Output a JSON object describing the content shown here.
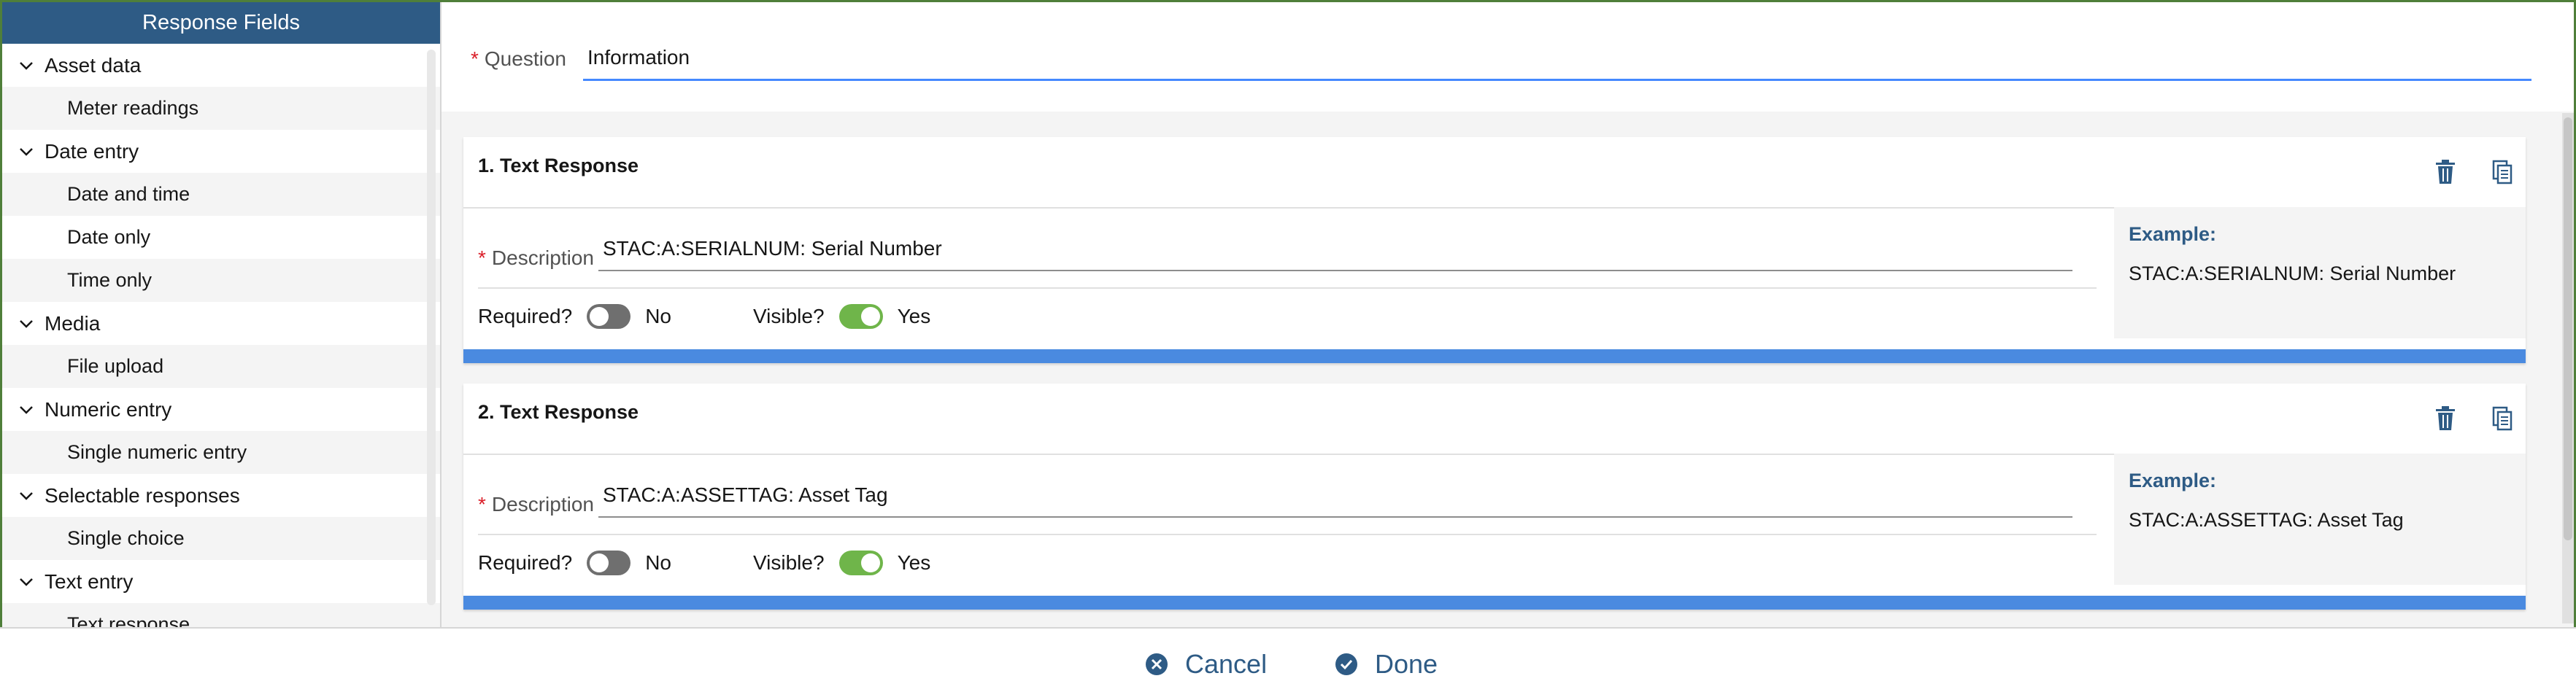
{
  "sidebar": {
    "title": "Response Fields",
    "groups": [
      {
        "label": "Asset data",
        "items": [
          "Meter readings"
        ]
      },
      {
        "label": "Date entry",
        "items": [
          "Date and time",
          "Date only",
          "Time only"
        ]
      },
      {
        "label": "Media",
        "items": [
          "File upload"
        ]
      },
      {
        "label": "Numeric entry",
        "items": [
          "Single numeric entry"
        ]
      },
      {
        "label": "Selectable responses",
        "items": [
          "Single choice"
        ]
      },
      {
        "label": "Text entry",
        "items": [
          "Text response"
        ]
      }
    ]
  },
  "question": {
    "required_mark": "*",
    "label": "Question",
    "value": "Information"
  },
  "responses": [
    {
      "title": "1. Text Response",
      "required_mark": "*",
      "description_label": "Description",
      "description_value": "STAC:A:SERIALNUM: Serial Number",
      "required_label": "Required?",
      "required_state": "No",
      "visible_label": "Visible?",
      "visible_state": "Yes",
      "example_label": "Example:",
      "example_value": "STAC:A:SERIALNUM: Serial Number"
    },
    {
      "title": "2. Text Response",
      "required_mark": "*",
      "description_label": "Description",
      "description_value": "STAC:A:ASSETTAG: Asset Tag",
      "required_label": "Required?",
      "required_state": "No",
      "visible_label": "Visible?",
      "visible_state": "Yes",
      "example_label": "Example:",
      "example_value": "STAC:A:ASSETTAG: Asset Tag"
    }
  ],
  "footer": {
    "cancel_label": "Cancel",
    "done_label": "Done"
  },
  "colors": {
    "header_bg": "#2e5b85",
    "accent_blue": "#4a8ae0",
    "toggle_on": "#6fb54a",
    "toggle_off": "#6f6f6f",
    "required_red": "#da1e28"
  }
}
